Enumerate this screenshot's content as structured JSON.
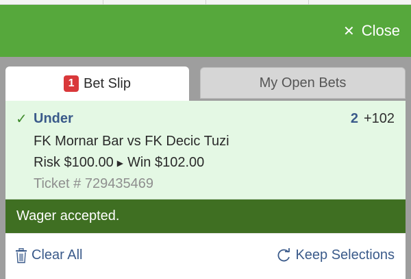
{
  "header": {
    "close_icon": "close-icon",
    "close_label": "Close",
    "bg_color": "#56a83c"
  },
  "tabs": {
    "bet_slip": {
      "badge": "1",
      "label": "Bet Slip"
    },
    "open_bets": {
      "label": "My Open Bets"
    }
  },
  "bet": {
    "selection": "Under",
    "line": "2",
    "price": "+102",
    "matchup": "FK Mornar Bar vs FK Decic Tuzi",
    "risk": "Risk $100.00",
    "win": "Win $102.00",
    "ticket": "Ticket # 729435469"
  },
  "status": {
    "message": "Wager accepted.",
    "color": "#3f6f22"
  },
  "footer": {
    "clear_all": "Clear All",
    "keep_selections": "Keep Selections"
  }
}
